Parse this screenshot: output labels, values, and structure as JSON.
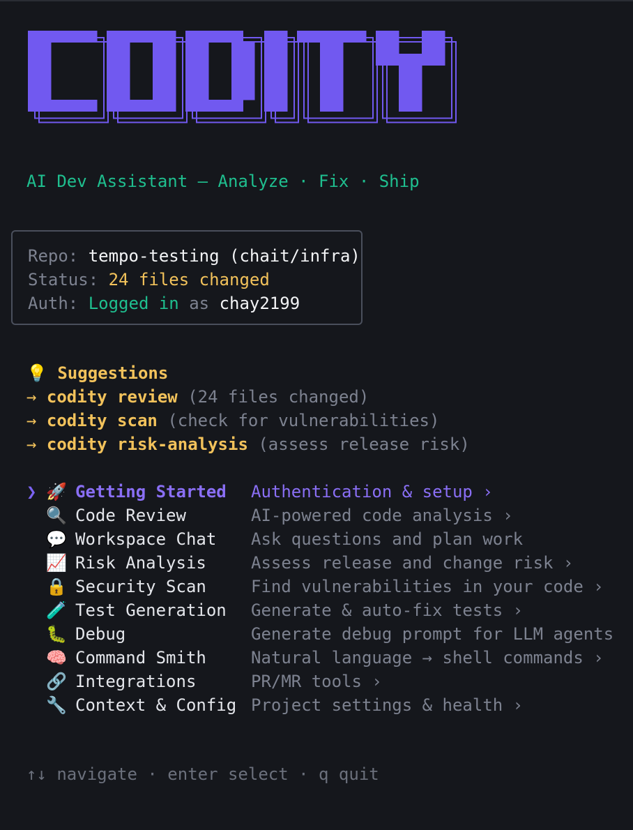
{
  "logo": {
    "text": "CODITY",
    "color": "#7159f0",
    "outline_color": "#7159f0"
  },
  "tagline": "AI Dev Assistant — Analyze · Fix · Ship",
  "info": {
    "repo_label": "Repo:",
    "repo_name": "tempo-testing",
    "repo_owner": "(chait/infra)",
    "status_label": "Status:",
    "status_value": "24 files changed",
    "auth_label": "Auth:",
    "auth_status": "Logged in",
    "auth_as": "as",
    "auth_user": "chay2199"
  },
  "suggestions": {
    "icon": "💡",
    "title": "Suggestions",
    "arrow": "→",
    "items": [
      {
        "command": "codity review",
        "note": "(24 files changed)"
      },
      {
        "command": "codity scan",
        "note": "(check for vulnerabilities)"
      },
      {
        "command": "codity risk-analysis",
        "note": "(assess release risk)"
      }
    ]
  },
  "menu": {
    "caret": "❯",
    "items": [
      {
        "icon": "🚀",
        "label": "Getting Started",
        "desc": "Authentication & setup ›",
        "selected": true
      },
      {
        "icon": "🔍",
        "label": "Code Review",
        "desc": "AI-powered code analysis ›"
      },
      {
        "icon": "💬",
        "label": "Workspace Chat",
        "desc": "Ask questions and plan work"
      },
      {
        "icon": "📈",
        "label": "Risk Analysis",
        "desc": "Assess release and change risk ›"
      },
      {
        "icon": "🔒",
        "label": "Security Scan",
        "desc": "Find vulnerabilities in your code ›"
      },
      {
        "icon": "🧪",
        "label": "Test Generation",
        "desc": "Generate & auto-fix tests ›"
      },
      {
        "icon": "🐛",
        "label": "Debug",
        "desc": "Generate debug prompt for LLM agents"
      },
      {
        "icon": "🧠",
        "label": "Command Smith",
        "desc": "Natural language → shell commands ›"
      },
      {
        "icon": "🔗",
        "label": "Integrations",
        "desc": "PR/MR tools ›"
      },
      {
        "icon": "🔧",
        "label": "Context & Config",
        "desc": "Project settings & health ›"
      }
    ]
  },
  "footer": "↑↓ navigate · enter select · q quit"
}
